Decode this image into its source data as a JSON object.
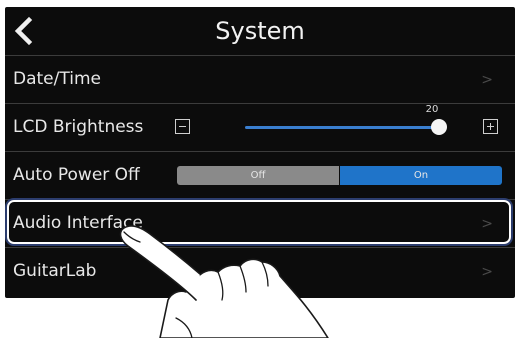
{
  "header": {
    "title": "System",
    "back_icon": "chevron-left-icon"
  },
  "rows": [
    {
      "label": "Date/Time",
      "arrow": ">"
    },
    {
      "label": "LCD Brightness",
      "value": "20",
      "level": 20,
      "minus_icon": "minus-box-icon",
      "plus_icon": "plus-box-icon"
    },
    {
      "label": "Auto Power Off",
      "off_label": "Off",
      "on_label": "On",
      "selected": "On"
    },
    {
      "label": "Audio Interface",
      "arrow": ">",
      "highlighted": true
    },
    {
      "label": "GuitarLab",
      "arrow": ">"
    }
  ],
  "overlay": {
    "pointer_icon": "tapping-hand-icon"
  },
  "colors": {
    "screen_bg": "#0c0c0c",
    "accent_blue": "#1f74c9",
    "toggle_off_gray": "#8a8a8a",
    "highlight_outline": "#2c3d6e"
  }
}
